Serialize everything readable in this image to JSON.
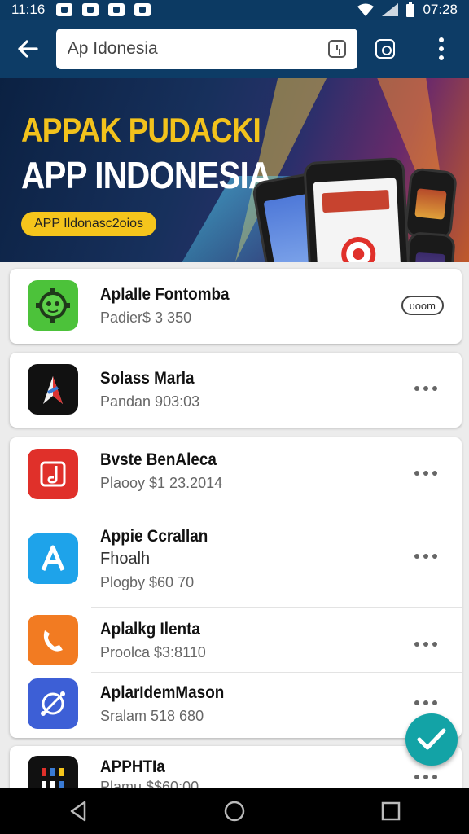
{
  "status_bar": {
    "time_left": "11:16",
    "time_right": "07:28"
  },
  "toolbar": {
    "search_value": "Ap Idonesia"
  },
  "banner": {
    "title_line1": "APPAK PUDACKI",
    "title_line2": "APP INDONESIA",
    "pill_text": "APP Ildonasc2oios"
  },
  "apps": [
    {
      "name": "Aplalle Fontomba",
      "sub": "Padier$ 3 350",
      "action": "ᴜᴏᴏm",
      "icon": "green-robot-icon"
    },
    {
      "name": "Solass Marla",
      "sub": "Pandan 903:03",
      "icon": "rocket-icon"
    },
    {
      "name": "Bvste BenAleca",
      "sub": "Plaooy $1 23.2014",
      "icon": "music-note-icon"
    },
    {
      "name": "Appie Ccrallan",
      "sub2": "Fhoalh",
      "sub": "Plogby $60 70",
      "icon": "letter-a-icon"
    },
    {
      "name": "Aplalkg Ilenta",
      "sub": "Proolca $3:8110",
      "icon": "phone-handset-icon"
    },
    {
      "name": "AplarIdemMason",
      "sub": "Sralam 518 680",
      "icon": "compass-icon"
    },
    {
      "name": "APPHTIa",
      "sub": "Plamu $$60:00",
      "icon": "photos-grid-icon"
    }
  ],
  "colors": {
    "toolbar": "#0d3c66",
    "banner_title": "#f2c21c",
    "fab": "#13a3a6"
  }
}
